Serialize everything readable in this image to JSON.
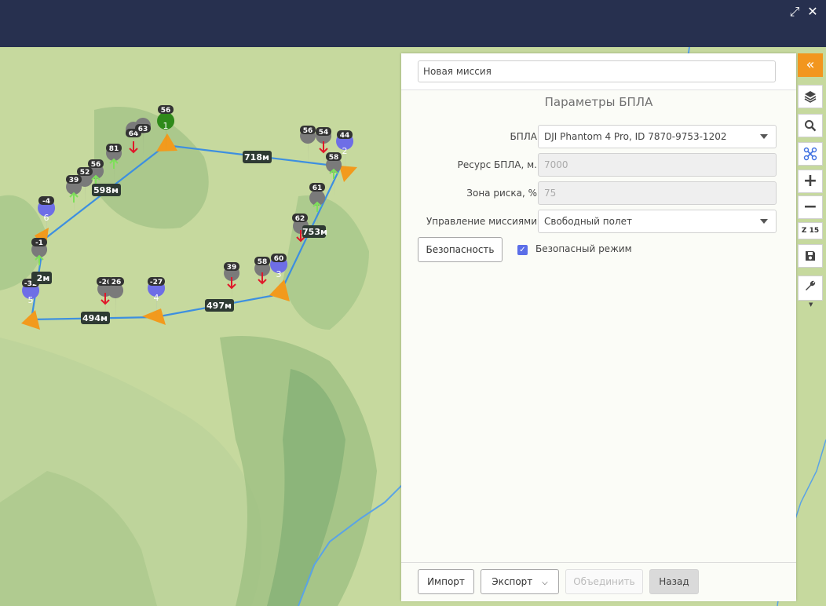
{
  "topbar": {
    "expand_icon": "⤢",
    "close_icon": "✕"
  },
  "map": {
    "distances": [
      "718м",
      "598м",
      "753м",
      "2м",
      "494м",
      "497м"
    ],
    "waypoints": [
      "1",
      "2",
      "3",
      "4",
      "5",
      "6"
    ],
    "markers": [
      "56",
      "64",
      "63",
      "81",
      "56",
      "52",
      "39",
      "-4",
      "-1",
      "56",
      "54",
      "44",
      "58",
      "61",
      "62",
      "39",
      "58",
      "60",
      "-26",
      "26",
      "-27",
      "-32"
    ]
  },
  "panel": {
    "mission_name": "Новая миссия",
    "title": "Параметры БПЛА",
    "fields": [
      {
        "label": "БПЛА",
        "value": "DJI Phantom 4 Pro, ID 7870-9753-1202"
      },
      {
        "label": "Ресурс БПЛА, м.",
        "value": "7000"
      },
      {
        "label": "Зона риска, %",
        "value": "75"
      },
      {
        "label": "Управление миссиями",
        "value": "Свободный полет"
      }
    ],
    "safety_button": "Безопасность",
    "safe_mode_label": "Безопасный режим",
    "footer": {
      "import": "Импорт",
      "export": "Экспорт",
      "merge": "Объединить",
      "back": "Назад"
    }
  },
  "toolbar": {
    "collapse_icon": "«",
    "layers_icon": "layers-icon",
    "search_icon": "search-icon",
    "drone_icon": "drone-icon",
    "zoom_in": "+",
    "zoom_out": "−",
    "zoom_level": "Z 15",
    "save_icon": "save-icon",
    "wrench_icon": "wrench-icon"
  },
  "colors": {
    "accent": "#f2961f",
    "header": "#27304f",
    "route": "#3d8fe0",
    "waypoint": "#6e6ee6",
    "start": "#2f8a1a"
  }
}
